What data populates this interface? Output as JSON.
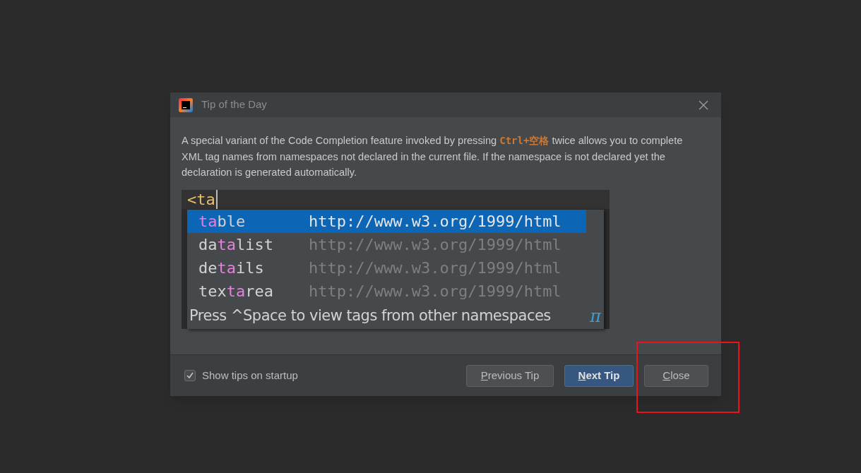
{
  "window": {
    "title": "Tip of the Day"
  },
  "tip_text": "A special variant of the Code Completion feature invoked by pressing **Ctrl+空格** twice allows you to complete XML tag names from namespaces not declared in the current file. If the namespace is not declared yet the declaration is generated automatically.",
  "editor": {
    "typed_text": "<ta",
    "completions": [
      {
        "match": "ta",
        "after": "ble",
        "namespace": "http://www.w3.org/1999/html",
        "selected": true
      },
      {
        "before": "da",
        "match": "ta",
        "after": "list",
        "namespace": "http://www.w3.org/1999/html",
        "selected": false
      },
      {
        "before": "de",
        "match": "ta",
        "after": "ils",
        "namespace": "http://www.w3.org/1999/html",
        "selected": false
      },
      {
        "before": "tex",
        "match": "ta",
        "after": "rea",
        "namespace": "http://www.w3.org/1999/html",
        "selected": false
      }
    ],
    "hint": "Press ^Space to view tags from other namespaces",
    "hint_symbol": "π"
  },
  "show_tips": {
    "label": "Show tips on startup",
    "checked": true
  },
  "buttons": [
    {
      "label": "Previous Tip",
      "kind": "plain"
    },
    {
      "label": "Next Tip",
      "kind": "default"
    },
    {
      "label": "Close",
      "kind": "plain"
    }
  ],
  "annotation": {
    "kind": "highlight",
    "color": "#e8141c"
  }
}
